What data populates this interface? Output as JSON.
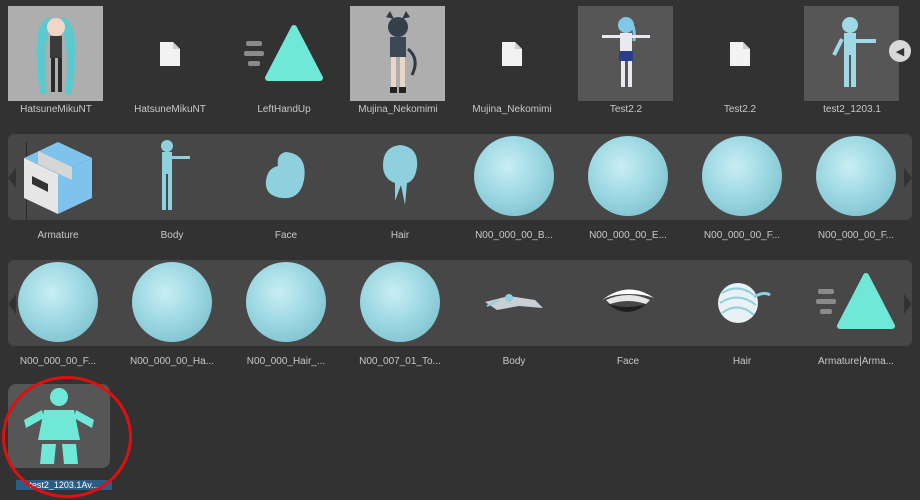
{
  "row1": [
    {
      "label": "HatsuneMikuNT",
      "icon": "model-prefab-icon"
    },
    {
      "label": "HatsuneMikuNT",
      "icon": "file-icon"
    },
    {
      "label": "LeftHandUp",
      "icon": "animation-clip-icon"
    },
    {
      "label": "Mujina_Nekomimi",
      "icon": "model-prefab-icon"
    },
    {
      "label": "Mujina_Nekomimi",
      "icon": "file-icon"
    },
    {
      "label": "Test2.2",
      "icon": "model-prefab-icon"
    },
    {
      "label": "Test2.2",
      "icon": "file-icon"
    },
    {
      "label": "test2_1203.1",
      "icon": "model-prefab-icon"
    }
  ],
  "strip1": [
    {
      "label": "Armature",
      "icon": "prefab-box-icon"
    },
    {
      "label": "Body",
      "icon": "mesh-body-icon"
    },
    {
      "label": "Face",
      "icon": "mesh-face-icon"
    },
    {
      "label": "Hair",
      "icon": "mesh-hair-icon"
    },
    {
      "label": "N00_000_00_B...",
      "icon": "material-sphere-icon"
    },
    {
      "label": "N00_000_00_E...",
      "icon": "material-sphere-icon"
    },
    {
      "label": "N00_000_00_F...",
      "icon": "material-sphere-icon"
    },
    {
      "label": "N00_000_00_F...",
      "icon": "material-sphere-icon"
    }
  ],
  "strip2": [
    {
      "label": "N00_000_00_F...",
      "icon": "material-sphere-icon"
    },
    {
      "label": "N00_000_00_Ha...",
      "icon": "material-sphere-icon"
    },
    {
      "label": "N00_000_Hair_...",
      "icon": "material-sphere-icon"
    },
    {
      "label": "N00_007_01_To...",
      "icon": "material-sphere-icon"
    },
    {
      "label": "Body",
      "icon": "mesh-body-icon"
    },
    {
      "label": "Face",
      "icon": "mesh-face-icon"
    },
    {
      "label": "Hair",
      "icon": "mesh-hair-icon"
    },
    {
      "label": "Armature|Arma...",
      "icon": "animation-clip-icon"
    }
  ],
  "row4": [
    {
      "label": "test2_1203.1Av...",
      "icon": "avatar-icon",
      "selected": true
    }
  ],
  "scroll_button": {
    "glyph": "◀"
  },
  "colors": {
    "background": "#323232",
    "strip": "#474747",
    "accent_cyan": "#6fe8d7",
    "selection": "#2c5d87",
    "annotation_red": "#e01010"
  }
}
